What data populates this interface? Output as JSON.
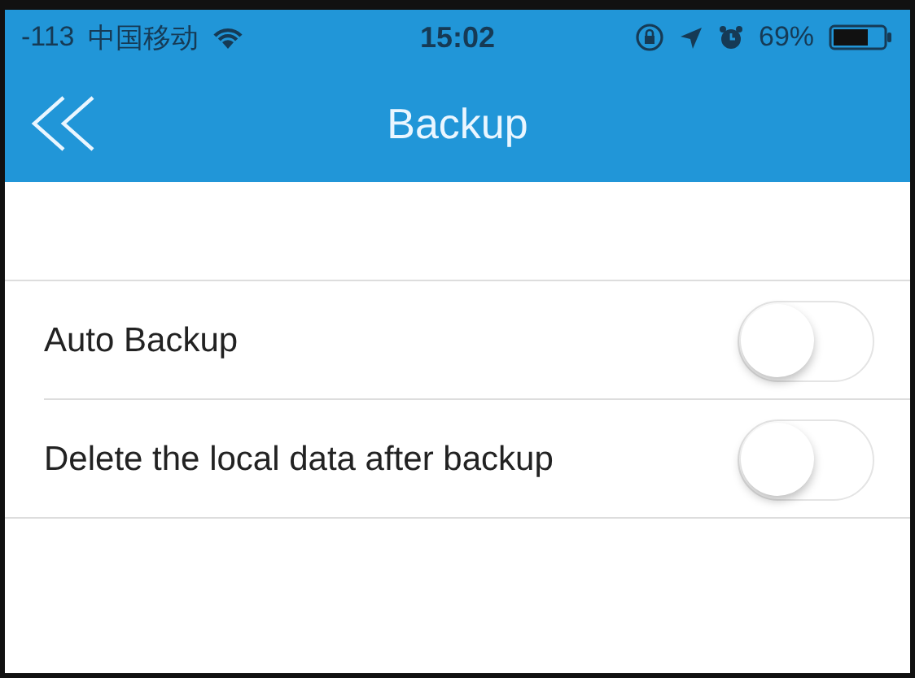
{
  "status_bar": {
    "signal": "-113",
    "carrier": "中国移动",
    "time": "15:02",
    "battery": "69%"
  },
  "nav_bar": {
    "title": "Backup"
  },
  "settings": [
    {
      "label": "Auto Backup",
      "on": false
    },
    {
      "label": "Delete the local data after backup",
      "on": false
    }
  ]
}
